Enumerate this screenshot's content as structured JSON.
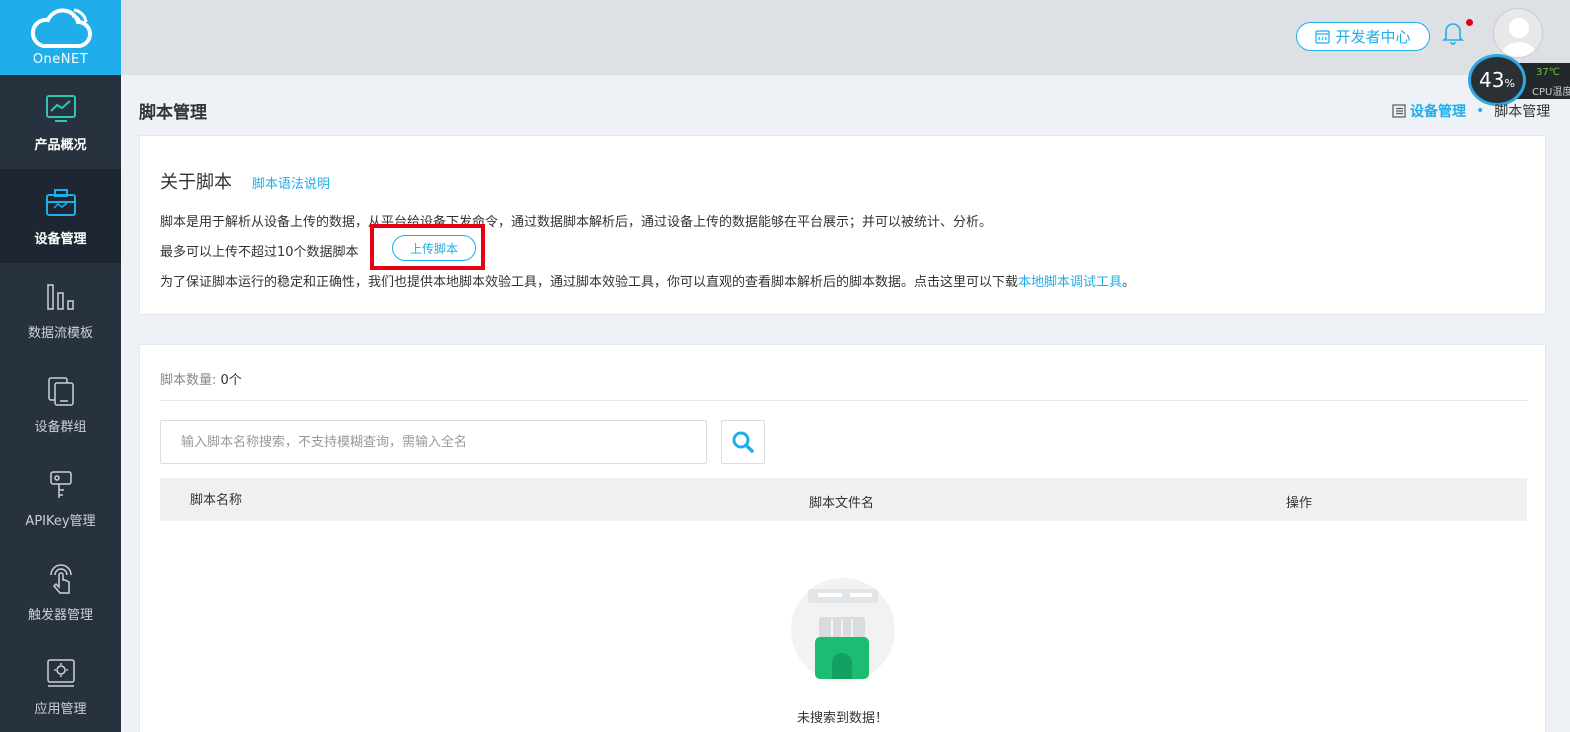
{
  "brand": {
    "name": "OneNET",
    "color": "#1faee9"
  },
  "sidebar": {
    "items": [
      {
        "label": "产品概况",
        "icon": "line-chart-monitor-icon"
      },
      {
        "label": "设备管理",
        "icon": "toolbox-icon"
      },
      {
        "label": "数据流模板",
        "icon": "bar-columns-icon"
      },
      {
        "label": "设备群组",
        "icon": "stacked-devices-icon"
      },
      {
        "label": "APIKey管理",
        "icon": "key-icon"
      },
      {
        "label": "触发器管理",
        "icon": "touch-hand-icon"
      },
      {
        "label": "应用管理",
        "icon": "gear-window-icon"
      }
    ]
  },
  "header": {
    "dev_center_label": "开发者中心",
    "cpu": {
      "percent": "43",
      "percent_unit": "%",
      "temp": "37℃",
      "label": "CPU温度"
    }
  },
  "page": {
    "title": "脚本管理",
    "breadcrumb": {
      "parent": "设备管理",
      "current": "脚本管理"
    }
  },
  "about": {
    "title": "关于脚本",
    "syntax_link": "脚本语法说明",
    "line1": "脚本是用于解析从设备上传的数据，从平台给设备下发命令，通过数据脚本解析后，通过设备上传的数据能够在平台展示；并可以被统计、分析。",
    "line2": "最多可以上传不超过10个数据脚本",
    "upload_button": "上传脚本",
    "line3_text": "为了保证脚本运行的稳定和正确性，我们也提供本地脚本效验工具，通过脚本效验工具，你可以直观的查看脚本解析后的脚本数据。点击这里可以下载",
    "line3_link": "本地脚本调试工具",
    "line3_end": "。"
  },
  "list": {
    "count_label": "脚本数量:",
    "count_value": "0个",
    "search_placeholder": "输入脚本名称搜索，不支持模糊查询，需输入全名",
    "columns": [
      "脚本名称",
      "脚本文件名",
      "操作"
    ],
    "empty_text": "未搜索到数据！"
  }
}
